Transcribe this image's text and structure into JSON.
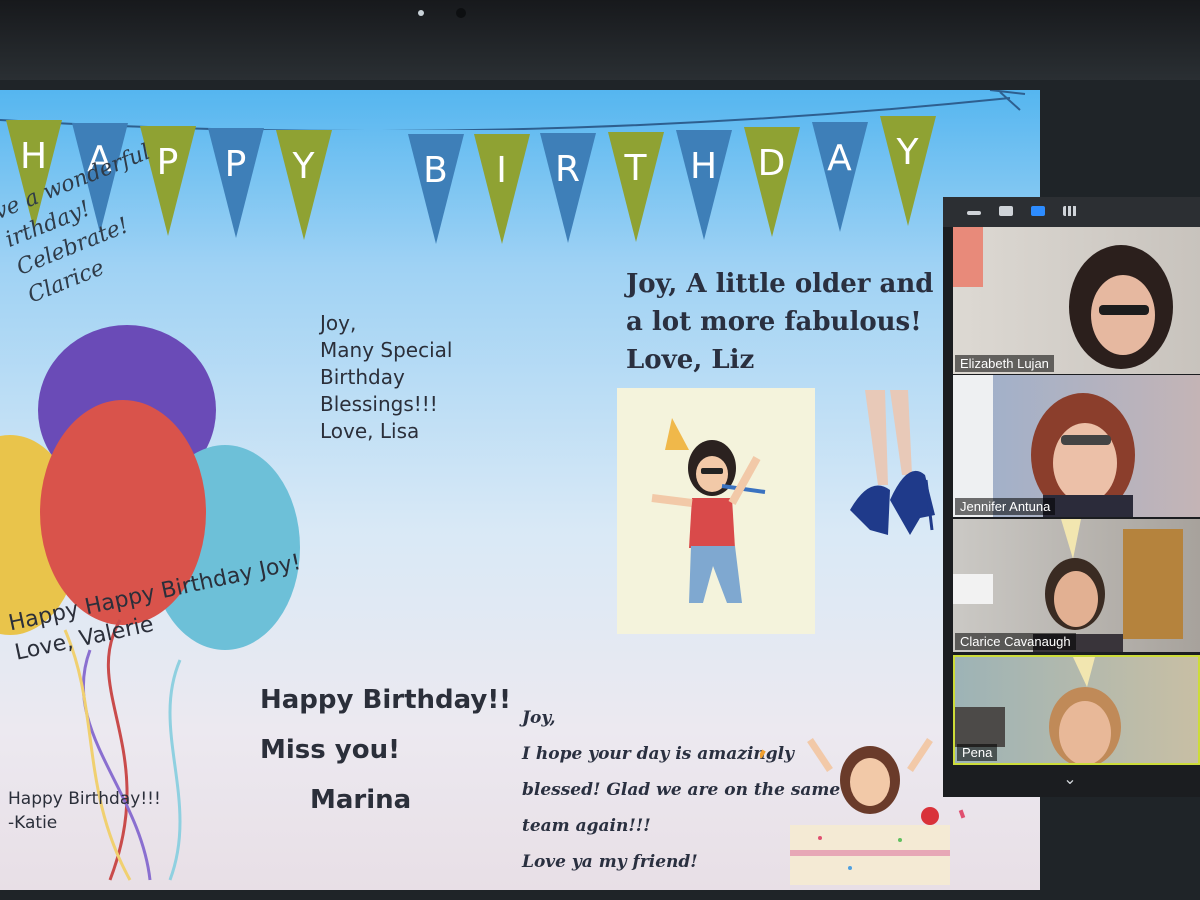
{
  "banner": {
    "word1": [
      "H",
      "A",
      "P",
      "P",
      "Y"
    ],
    "word2": [
      "B",
      "I",
      "R",
      "T",
      "H",
      "D",
      "A",
      "Y"
    ]
  },
  "messages": {
    "clarice": [
      "ve a wonderful",
      "irthday!",
      "Celebrate!",
      "Clarice"
    ],
    "lisa": [
      "Joy,",
      "Many Special",
      "Birthday",
      "Blessings!!!",
      "Love, Lisa"
    ],
    "valerie": [
      "Happy Happy Birthday Joy!",
      "Love, Valerie"
    ],
    "marina": [
      "Happy Birthday!!",
      "Miss you!",
      "Marina"
    ],
    "katie": [
      "Happy Birthday!!!",
      "-Katie"
    ],
    "liz": [
      "Joy, A little older and",
      "a lot more fabulous!",
      "Love, Liz"
    ],
    "jennifer": [
      "Joy,",
      "I hope your day is amazingly",
      "blessed! Glad we are on the same",
      "team again!!!",
      "Love ya my friend!"
    ]
  },
  "zoom": {
    "participants": [
      {
        "name": "Elizabeth Lujan"
      },
      {
        "name": "Jennifer Antuna"
      },
      {
        "name": "Clarice Cavanaugh"
      },
      {
        "name": "Pena"
      }
    ],
    "icons": [
      "minimize-icon",
      "single-view-icon",
      "speaker-view-icon",
      "gallery-view-icon"
    ],
    "colors": {
      "active_speaker": "#cddc39"
    }
  },
  "colors": {
    "pennant_olive": "#8fa233",
    "pennant_blue": "#3e7fb8",
    "balloon_purple": "#6a4bb7",
    "balloon_red": "#d9534b",
    "balloon_teal": "#6dc0d8",
    "balloon_yellow": "#e9c44b"
  }
}
